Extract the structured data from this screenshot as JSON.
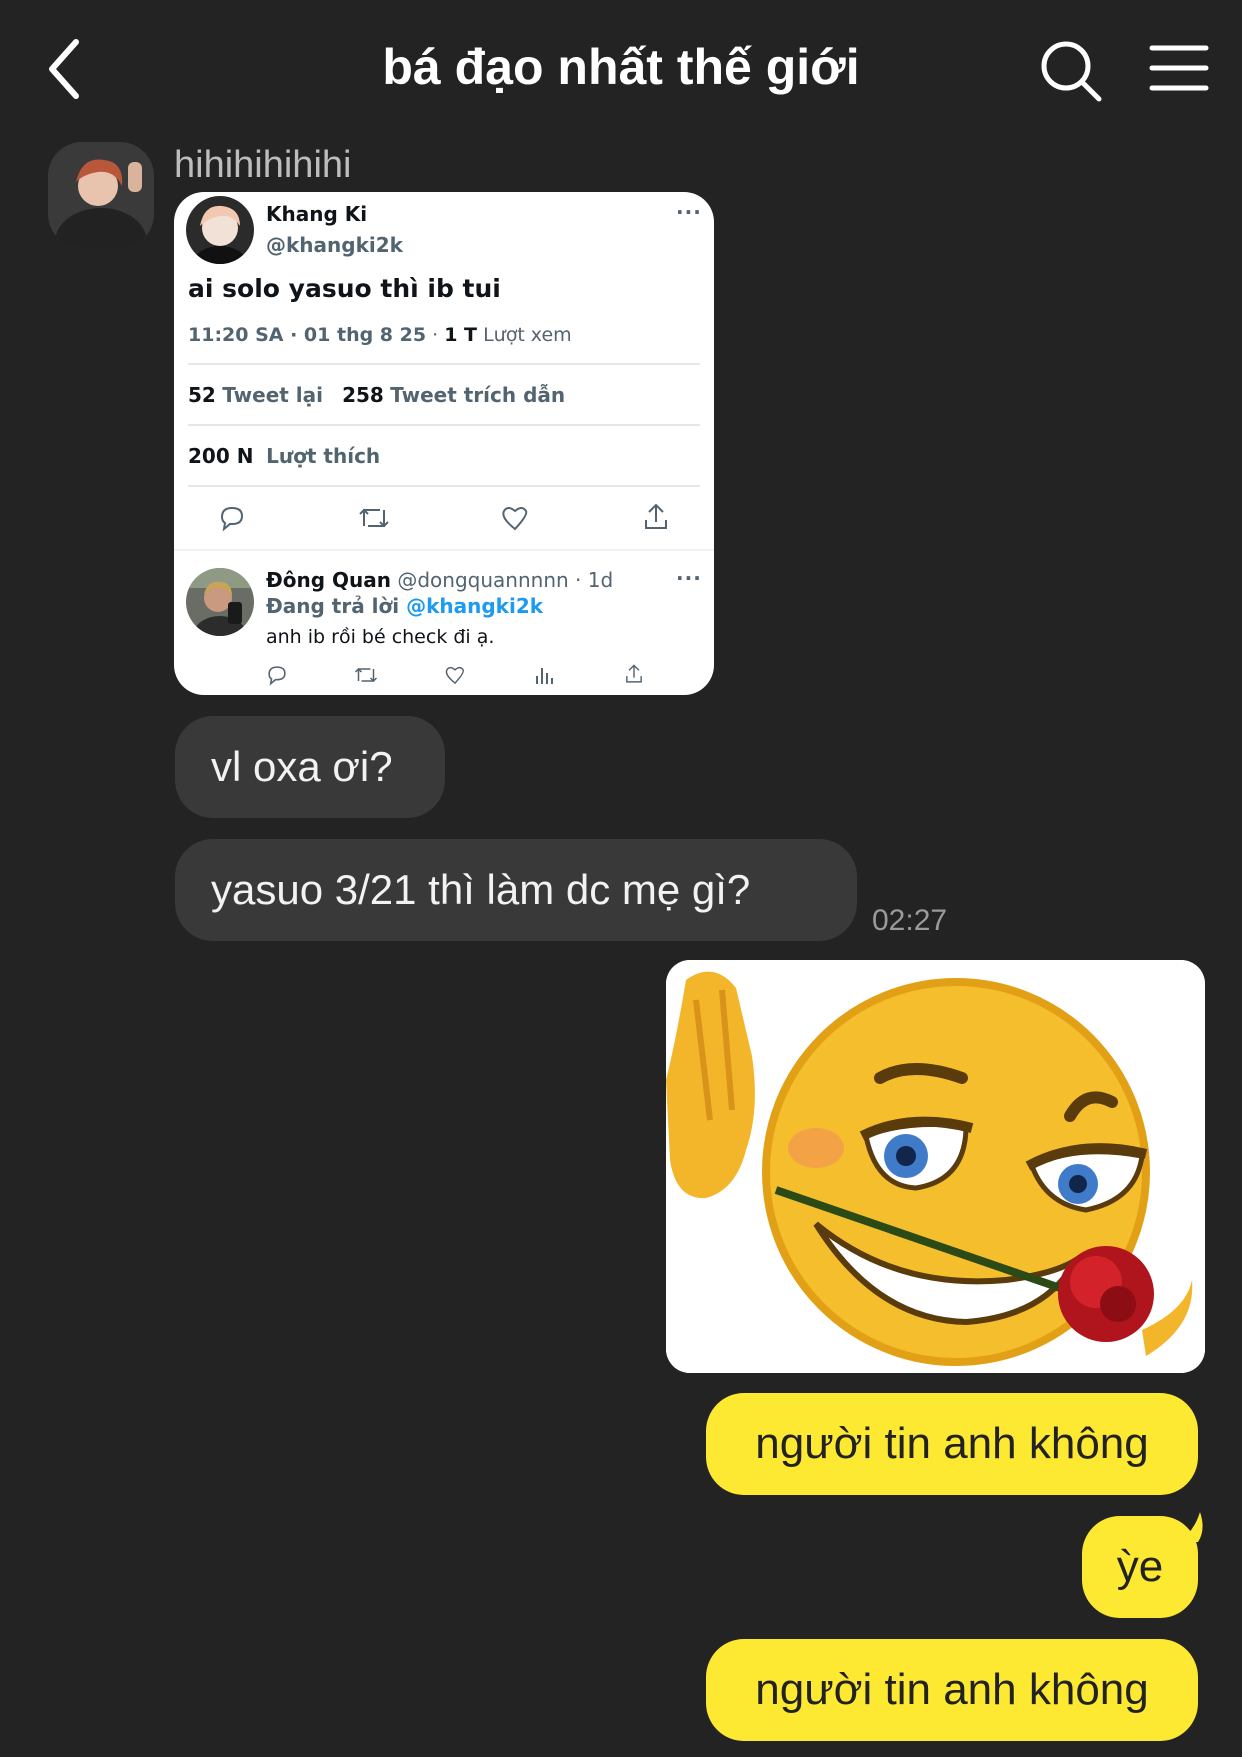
{
  "header": {
    "title": "bá đạo nhất thế giới"
  },
  "messages": {
    "sender_name": "hihihihihihi",
    "tweet": {
      "author_name": "Khang Ki",
      "author_handle": "@khangki2k",
      "text": "ai solo yasuo thì ib tui",
      "time": "11:20 SA · 01 thg 8 25",
      "views_count": "1 T",
      "views_label": "Lượt xem",
      "retweets_count": "52",
      "retweets_label": "Tweet lại",
      "quotes_count": "258",
      "quotes_label": "Tweet trích dẫn",
      "likes_count": "200 N",
      "likes_label": "Lượt thích",
      "reply": {
        "author_name": "Đông Quan",
        "author_handle": "@dongquannnnn · 1d",
        "replying_label": "Đang trả lời",
        "replying_to": "@khangki2k",
        "text": "anh ib rồi bé check đi ạ."
      }
    },
    "incoming": [
      {
        "text": "vl oxa ơi?"
      },
      {
        "text": "yasuo 3/21 thì làm dc mẹ gì?"
      }
    ],
    "incoming_time": "02:27",
    "outgoing": [
      {
        "text": "người tin anh không"
      },
      {
        "text": "ỳe"
      },
      {
        "text": "người tin anh không"
      }
    ]
  },
  "icons": [
    "chevron-left-icon",
    "search-icon",
    "hamburger-menu-icon",
    "reply-icon",
    "retweet-icon",
    "heart-icon",
    "share-icon",
    "stats-icon",
    "more-dots-icon"
  ],
  "colors": {
    "background": "#232323",
    "incoming_bubble": "#393939",
    "outgoing_bubble": "#fde932",
    "link": "#1d9bf0"
  }
}
